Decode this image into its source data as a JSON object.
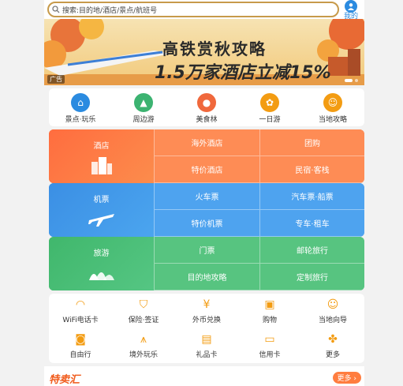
{
  "search": {
    "placeholder": "搜索:目的地/酒店/景点/航班号"
  },
  "profile": {
    "label": "我的"
  },
  "banner": {
    "line1": "高铁赏秋攻略",
    "line2": "1.5万家酒店立减15%",
    "ad_tag": "广告"
  },
  "quick_links": [
    {
      "label": "景点·玩乐",
      "icon": "landmark-icon",
      "color": "#2b8be0"
    },
    {
      "label": "周边游",
      "icon": "mountain-icon",
      "color": "#3cb371"
    },
    {
      "label": "美食林",
      "icon": "food-icon",
      "color": "#f0683c"
    },
    {
      "label": "一日游",
      "icon": "sun-icon",
      "color": "#f39c12"
    },
    {
      "label": "当地攻略",
      "icon": "guide-icon",
      "color": "#f39c12"
    }
  ],
  "hotel_group": {
    "main": "酒店",
    "items": [
      "海外酒店",
      "团购",
      "特价酒店",
      "民宿·客栈"
    ]
  },
  "transport_group": {
    "main": "机票",
    "items": [
      "火车票",
      "汽车票·船票",
      "特价机票",
      "专车·租车"
    ]
  },
  "tour_group": {
    "main": "旅游",
    "items": [
      "门票",
      "邮轮旅行",
      "目的地攻略",
      "定制旅行"
    ]
  },
  "services": [
    {
      "label": "WiFi电话卡",
      "icon": "wifi-icon"
    },
    {
      "label": "保险·签证",
      "icon": "shield-icon"
    },
    {
      "label": "外币兑换",
      "icon": "currency-icon"
    },
    {
      "label": "购物",
      "icon": "shopping-bag-icon"
    },
    {
      "label": "当地向导",
      "icon": "guide-icon"
    },
    {
      "label": "自由行",
      "icon": "backpack-icon"
    },
    {
      "label": "境外玩乐",
      "icon": "eiffel-icon"
    },
    {
      "label": "礼品卡",
      "icon": "gift-card-icon"
    },
    {
      "label": "信用卡",
      "icon": "credit-card-icon"
    },
    {
      "label": "更多",
      "icon": "more-icon"
    }
  ],
  "special": {
    "title": "特卖汇",
    "more": "更多"
  }
}
